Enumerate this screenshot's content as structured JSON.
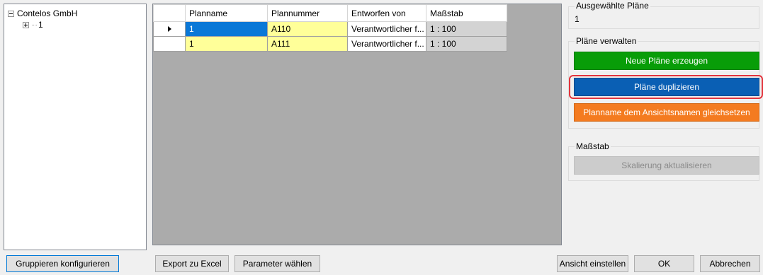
{
  "tree": {
    "root_label": "Contelos GmbH",
    "child_label": "1"
  },
  "grid": {
    "columns": [
      "Planname",
      "Plannummer",
      "Entworfen von",
      "Maßstab"
    ],
    "rows": [
      {
        "planname": "1",
        "plannummer": "A110",
        "entworfen_von": "Verantwortlicher f...",
        "massstab": "1 : 100"
      },
      {
        "planname": "1",
        "plannummer": "A111",
        "entworfen_von": "Verantwortlicher f...",
        "massstab": "1 : 100"
      }
    ]
  },
  "selected_plans": {
    "title": "Ausgewählte Pläne",
    "value": "1"
  },
  "manage_plans": {
    "title": "Pläne verwalten",
    "new_label": "Neue Pläne erzeugen",
    "duplicate_label": "Pläne duplizieren",
    "rename_label": "Planname dem Ansichtsnamen gleichsetzen"
  },
  "scale_group": {
    "title": "Maßstab",
    "update_label": "Skalierung aktualisieren"
  },
  "footer": {
    "group_config": "Gruppieren konfigurieren",
    "export_excel": "Export zu Excel",
    "choose_params": "Parameter wählen",
    "set_view": "Ansicht einstellen",
    "ok": "OK",
    "cancel": "Abbrechen"
  },
  "colors": {
    "green": "#089d08",
    "blue": "#0a5fb4",
    "orange": "#f47b20",
    "selection": "#0a78d7",
    "highlight_yellow": "#ffff99",
    "focus_ring": "#e3343d"
  }
}
